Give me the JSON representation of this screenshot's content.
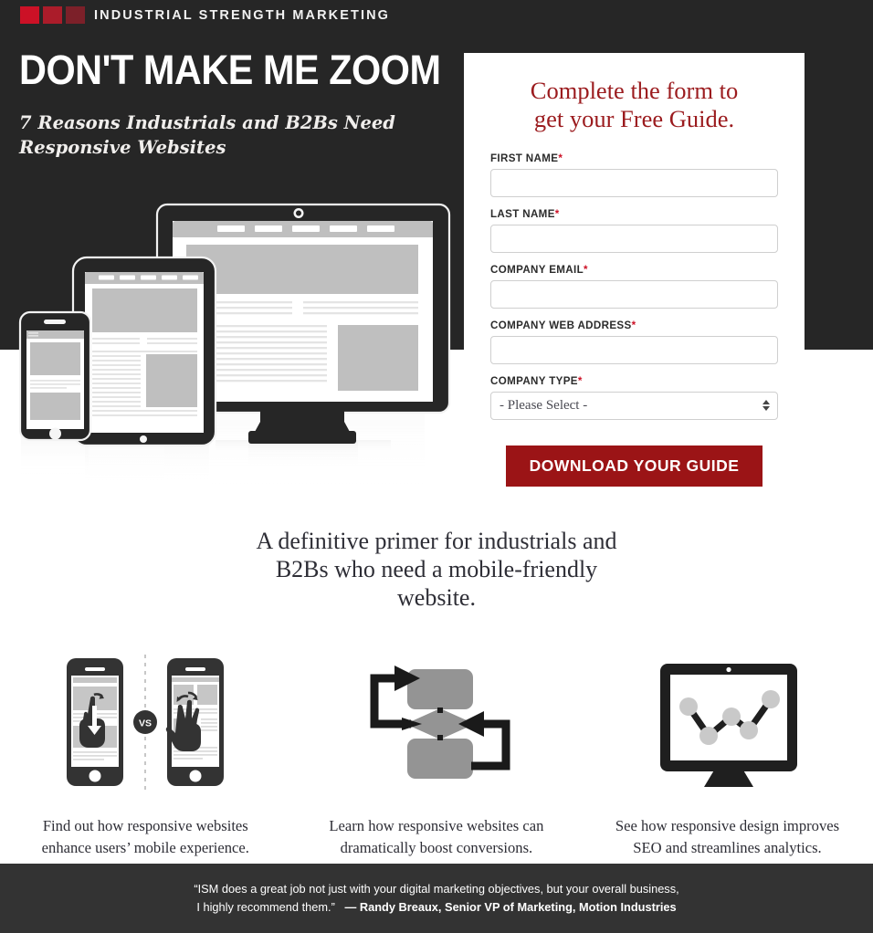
{
  "brand": {
    "logo_text": "INDUSTRIAL STRENGTH MARKETING",
    "square_colors": [
      "#cc1126",
      "#ab1c2a",
      "#7c2029"
    ],
    "accent_red": "#cc1126",
    "button_red": "#9b1416",
    "heading_serif_red": "#9b1b1e",
    "dark_band": "#262626",
    "footer_bg": "#333333"
  },
  "hero": {
    "headline": "DON'T MAKE ME ZOOM",
    "subheadline": "7 Reasons Industrials and B2Bs Need Responsive Websites",
    "illustration_name": "responsive-devices-illustration"
  },
  "form": {
    "title_line1": "Complete the form to",
    "title_line2": "get your Free Guide.",
    "fields": [
      {
        "label": "FIRST NAME",
        "required": true,
        "value": "",
        "placeholder": "",
        "type": "text",
        "name": "first-name"
      },
      {
        "label": "LAST NAME",
        "required": true,
        "value": "",
        "placeholder": "",
        "type": "text",
        "name": "last-name"
      },
      {
        "label": "COMPANY EMAIL",
        "required": true,
        "value": "",
        "placeholder": "",
        "type": "text",
        "name": "company-email"
      },
      {
        "label": "COMPANY WEB ADDRESS",
        "required": true,
        "value": "",
        "placeholder": "",
        "type": "text",
        "name": "company-web-address"
      },
      {
        "label": "COMPANY TYPE",
        "required": true,
        "value": "- Please Select -",
        "type": "select",
        "name": "company-type"
      }
    ],
    "select_options": [
      "- Please Select -"
    ],
    "required_marker": "*",
    "submit_label": "DOWNLOAD YOUR GUIDE"
  },
  "primer": {
    "line1": "A definitive primer for industrials and",
    "line2": "B2Bs who need a mobile-friendly",
    "line3": "website."
  },
  "benefits": [
    {
      "icon": "two-phones-vs-icon",
      "vs_label": "VS",
      "caption_line1": "Find out how responsive websites",
      "caption_line2": "enhance users’ mobile experience."
    },
    {
      "icon": "conversion-flow-diagram-icon",
      "caption_line1": "Learn how responsive websites can",
      "caption_line2": "dramatically boost conversions."
    },
    {
      "icon": "monitor-analytics-chart-icon",
      "caption_line1": "See how responsive design improves",
      "caption_line2": "SEO and streamlines analytics."
    }
  ],
  "footer": {
    "quote_line1": "“ISM does a great job not just with your digital marketing objectives, but your overall business,",
    "quote_line2": "I highly recommend them.”",
    "attribution": "— Randy Breaux, Senior VP of Marketing, Motion Industries"
  }
}
